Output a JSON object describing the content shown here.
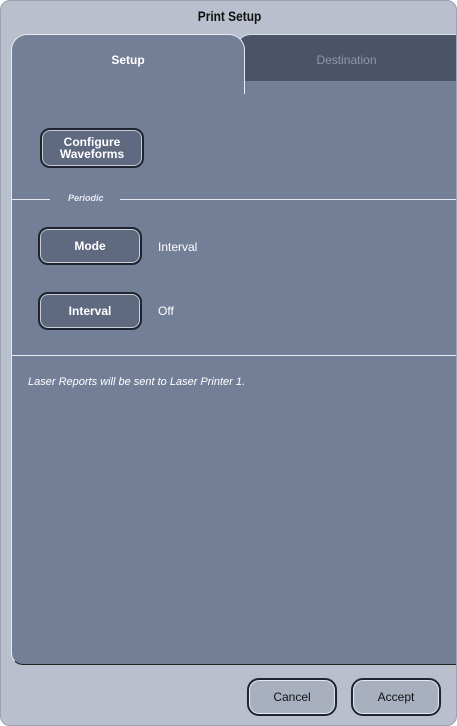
{
  "dialog": {
    "title": "Print Setup"
  },
  "tabs": {
    "setup": "Setup",
    "destination": "Destination"
  },
  "setup": {
    "configure_waveforms_line1": "Configure",
    "configure_waveforms_line2": "Waveforms",
    "periodic_label": "Periodic",
    "mode_button": "Mode",
    "mode_value": "Interval",
    "interval_button": "Interval",
    "interval_value": "Off",
    "info_message": "Laser Reports will be sent to Laser Printer 1."
  },
  "footer": {
    "cancel": "Cancel",
    "accept": "Accept"
  },
  "colors": {
    "dialog_bg": "#b9bfcc",
    "panel_bg": "#737f97",
    "inactive_tab_bg": "#4b5467",
    "button_bg": "#5f6a80"
  }
}
